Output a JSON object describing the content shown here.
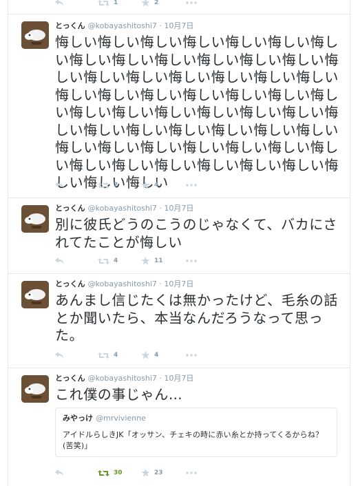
{
  "tweets": [
    {
      "fullname": "",
      "username": "",
      "time": "",
      "text": "",
      "actions": {
        "retweets": "1",
        "favorites": "2",
        "retweeted": false
      }
    },
    {
      "fullname": "とっくん",
      "username": "@kobayashitoshi7",
      "time": "10月7日",
      "text": "悔しい悔しい悔しい悔しい悔しい悔しい悔しい悔しい悔しい悔しい悔しい悔しい悔しい悔しい悔しい悔しい悔しい悔しい悔しい悔しい悔しい悔しい悔しい悔しい悔しい悔しい悔しい悔しい悔しい悔しい悔しい悔しい悔しい悔しい悔しい悔しい悔しい悔しい悔しい悔しい悔しい悔しい悔しい悔しい悔しい悔しい悔しい悔しい悔しい悔しい悔しい悔しい悔しい悔しい悔しい悔しい",
      "actions": {
        "retweets": "2",
        "favorites": "4",
        "retweeted": false
      }
    },
    {
      "fullname": "とっくん",
      "username": "@kobayashitoshi7",
      "time": "10月7日",
      "text": "別に彼氏どうのこうのじゃなくて、バカにされてたことが悔しい",
      "actions": {
        "retweets": "4",
        "favorites": "11",
        "retweeted": false
      }
    },
    {
      "fullname": "とっくん",
      "username": "@kobayashitoshi7",
      "time": "10月7日",
      "text": "あんまし信じたくは無かったけど、毛糸の話とか聞いたら、本当なんだろうなって思った。",
      "actions": {
        "retweets": "4",
        "favorites": "4",
        "retweeted": false
      }
    },
    {
      "fullname": "とっくん",
      "username": "@kobayashitoshi7",
      "time": "10月7日",
      "text": "これ僕の事じゃん…",
      "quote": {
        "fullname": "みやっけ",
        "username": "@mrvivienne",
        "text": "アイドルらしきJK「オッサン、チェキの時に赤い糸とか持ってくるからね？(苦笑)」"
      },
      "actions": {
        "retweets": "30",
        "favorites": "23",
        "retweeted": true
      }
    }
  ],
  "separator": "·",
  "colors": {
    "muted": "#8899a6",
    "text": "#292f33",
    "border": "#e1e8ed",
    "retweet_active": "#609928",
    "avatar_bg": "#6b5036"
  },
  "icons": {
    "reply": "reply-icon",
    "retweet": "retweet-icon",
    "favorite": "star-icon",
    "more": "more-dots-icon"
  }
}
